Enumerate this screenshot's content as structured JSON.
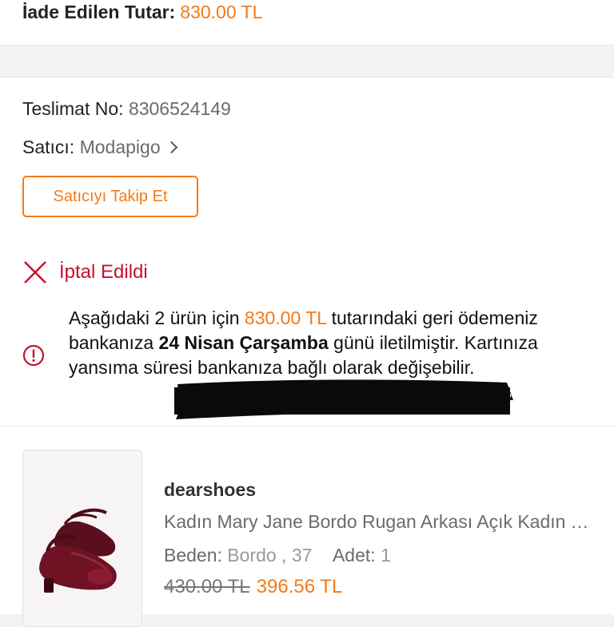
{
  "refund": {
    "label": "İade Edilen Tutar:",
    "amount": "830.00 TL"
  },
  "delivery": {
    "number_label": "Teslimat No:",
    "number_value": "8306524149",
    "seller_label": "Satıcı:",
    "seller_name": "Modapigo",
    "follow_button": "Satıcıyı Takip Et"
  },
  "status": {
    "title": "İptal Edildi",
    "info_part1": "Aşağıdaki 2 ürün için ",
    "info_amount": "830.00 TL",
    "info_part2": " tutarındaki geri ödemeniz bankanıza ",
    "info_date": "24 Nisan Çarşamba",
    "info_part3": " günü iletilmiştir. Kartınıza yansıma süresi bankanıza bağlı olarak değişebilir."
  },
  "product": {
    "brand": "dearshoes",
    "name": "Kadın Mary Jane Bordo Rugan Arkası Açık Kadın Topuklu Ayakkabı",
    "size_label": "Beden:",
    "size_value": "Bordo , 37",
    "qty_label": "Adet:",
    "qty_value": "1",
    "old_price": "430.00 TL",
    "new_price": "396.56 TL"
  },
  "colors": {
    "accent": "#f27a1a",
    "cancel": "#c8102e"
  },
  "icons": {
    "cancel": "close-icon",
    "info": "info-circle-icon",
    "seller_chevron": "chevron-right-icon"
  }
}
